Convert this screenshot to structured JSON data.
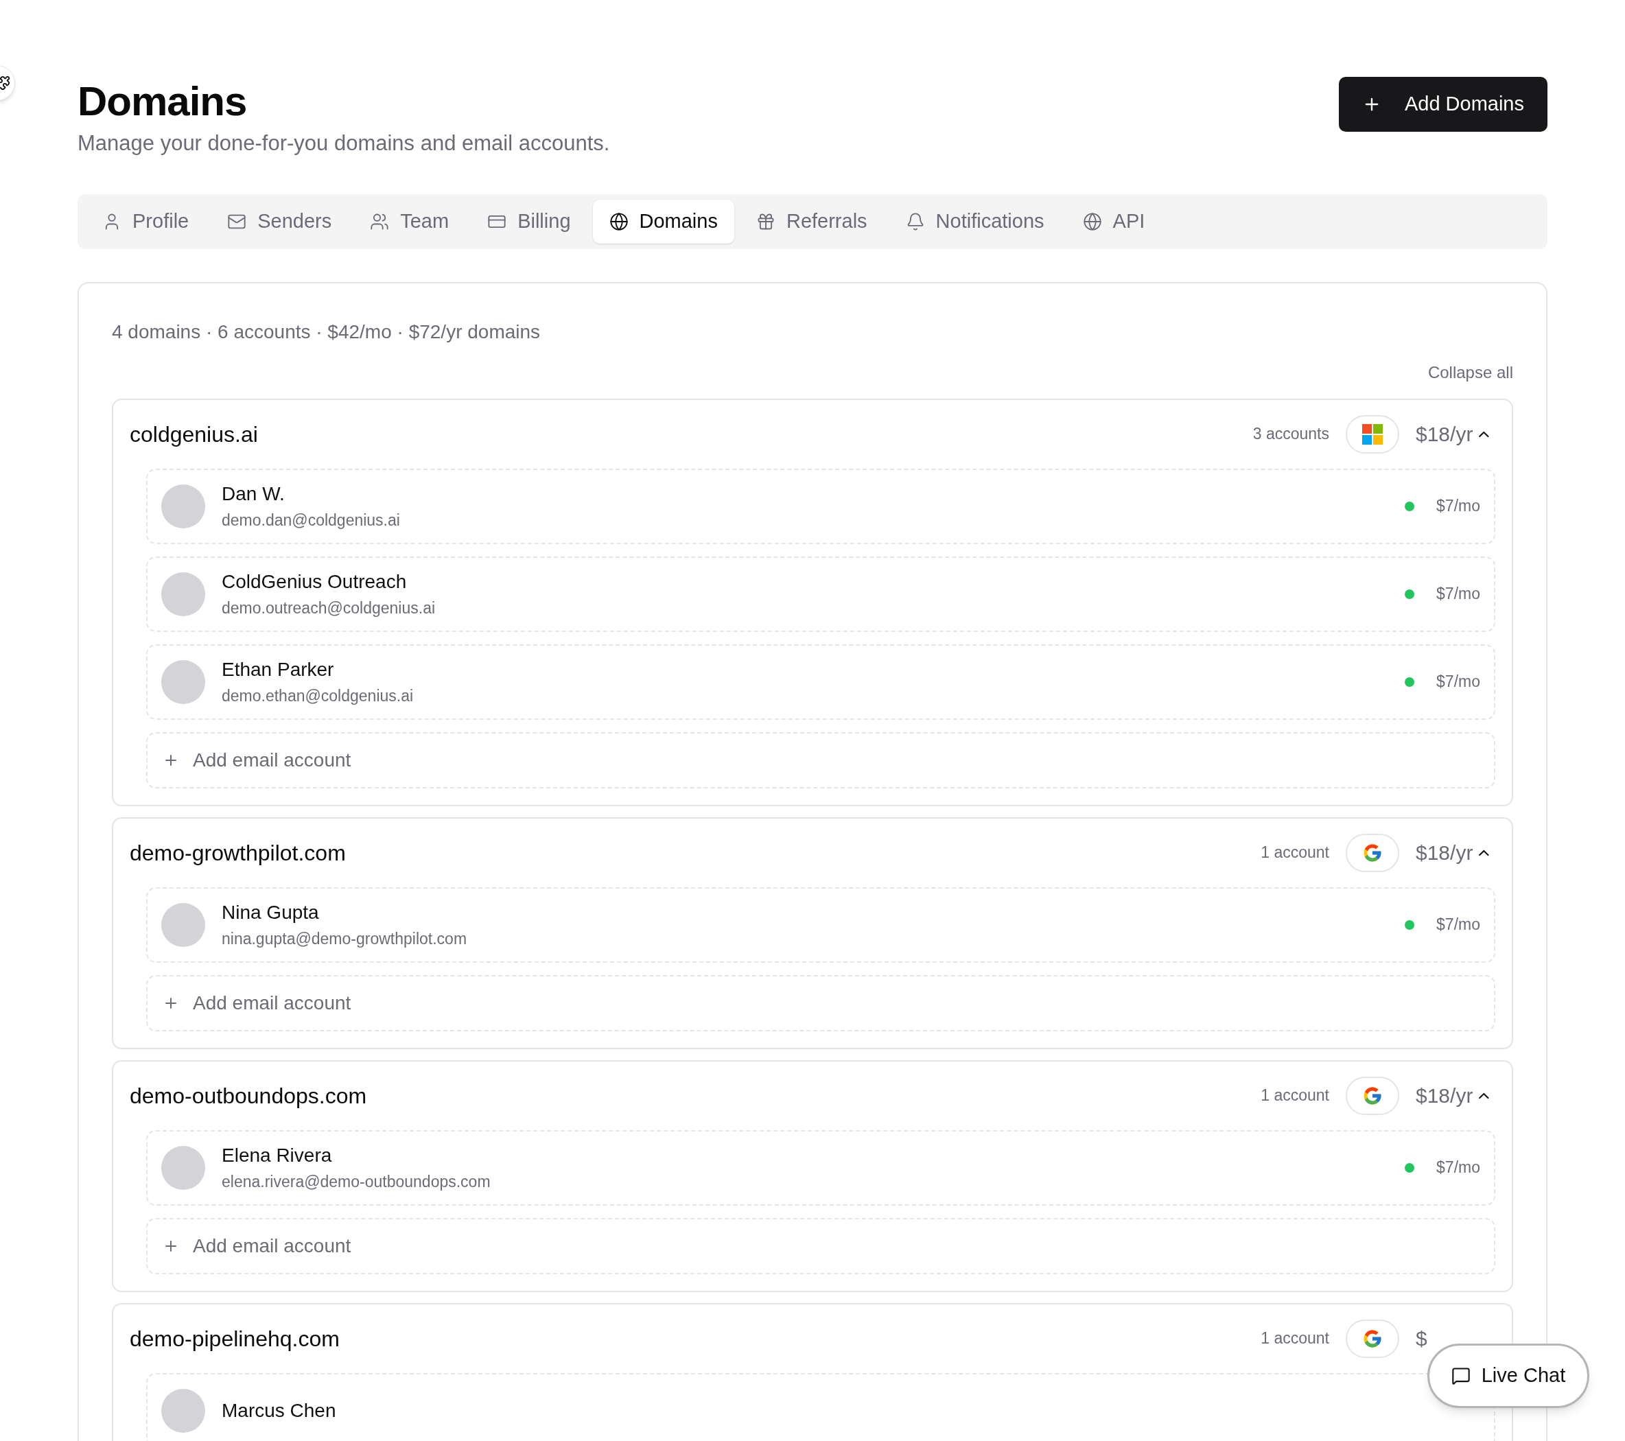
{
  "page": {
    "title": "Domains",
    "subtitle": "Manage your done-for-you domains and email accounts.",
    "add_button": "Add Domains"
  },
  "tabs": [
    {
      "label": "Profile",
      "selected": false
    },
    {
      "label": "Senders",
      "selected": false
    },
    {
      "label": "Team",
      "selected": false
    },
    {
      "label": "Billing",
      "selected": false
    },
    {
      "label": "Domains",
      "selected": true
    },
    {
      "label": "Referrals",
      "selected": false
    },
    {
      "label": "Notifications",
      "selected": false
    },
    {
      "label": "API",
      "selected": false
    }
  ],
  "summary": "4 domains · 6 accounts · $42/mo · $72/yr domains",
  "collapse_all": "Collapse all",
  "domains": [
    {
      "name": "coldgenius.ai",
      "accounts_count": "3 accounts",
      "kind": "microsoft",
      "price": "$18/yr",
      "expanded": true,
      "add_label": "Add email account",
      "accounts": [
        {
          "name": "Dan W.",
          "email": "demo.dan@coldgenius.ai",
          "color": "#22c55e",
          "price": "$7/mo"
        },
        {
          "name": "ColdGenius Outreach",
          "email": "demo.outreach@coldgenius.ai",
          "color": "#22c55e",
          "price": "$7/mo"
        },
        {
          "name": "Ethan Parker",
          "email": "demo.ethan@coldgenius.ai",
          "color": "#22c55e",
          "price": "$7/mo"
        }
      ]
    },
    {
      "name": "demo-growthpilot.com",
      "accounts_count": "1 account",
      "kind": "google",
      "price": "$18/yr",
      "expanded": true,
      "add_label": "Add email account",
      "accounts": [
        {
          "name": "Nina Gupta",
          "email": "nina.gupta@demo-growthpilot.com",
          "color": "#22c55e",
          "price": "$7/mo"
        }
      ]
    },
    {
      "name": "demo-outboundops.com",
      "accounts_count": "1 account",
      "kind": "google",
      "price": "$18/yr",
      "expanded": true,
      "add_label": "Add email account",
      "accounts": [
        {
          "name": "Elena Rivera",
          "email": "elena.rivera@demo-outboundops.com",
          "color": "#22c55e",
          "price": "$7/mo"
        }
      ]
    },
    {
      "name": "demo-pipelinehq.com",
      "accounts_count": "1 account",
      "kind": "google",
      "price": "$",
      "accounts": [
        {
          "name": "Marcus Chen"
        }
      ]
    }
  ],
  "live_chat": "Live Chat"
}
